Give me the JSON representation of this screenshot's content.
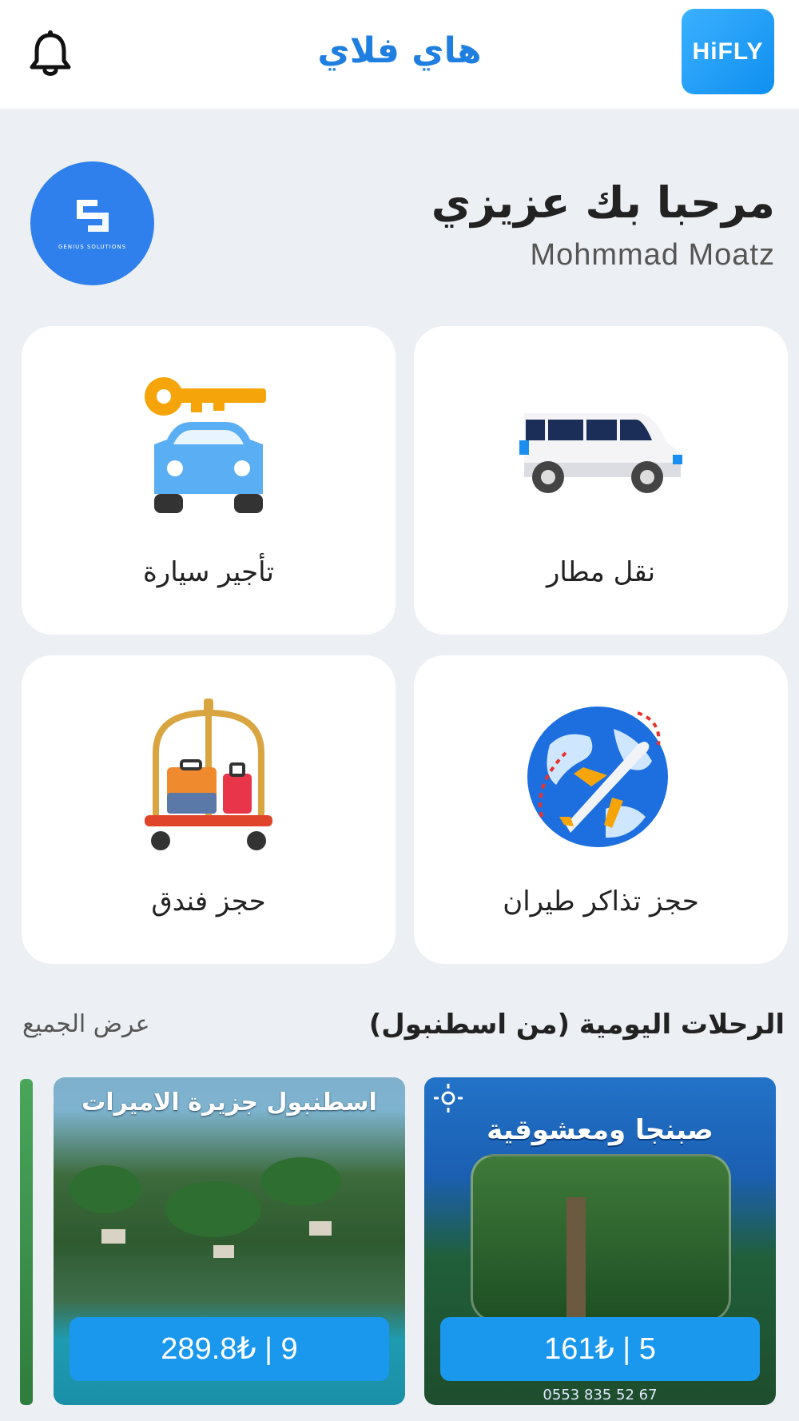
{
  "header": {
    "title": "هاي فلاي",
    "logo_text": "HiFLY",
    "notification_icon": "bell-icon"
  },
  "greeting": {
    "title": "مرحبا بك عزيزي",
    "name": "Mohmmad Moatz",
    "company_logo_text": "GENIUS SOLUTIONS"
  },
  "services": [
    {
      "label": "نقل مطار",
      "icon": "van-icon"
    },
    {
      "label": "تأجير سيارة",
      "icon": "car-key-icon"
    },
    {
      "label": "حجز تذاكر طيران",
      "icon": "globe-plane-icon"
    },
    {
      "label": "حجز فندق",
      "icon": "luggage-cart-icon"
    }
  ],
  "daily_trips": {
    "title": "الرحلات اليومية (من اسطنبول)",
    "view_all": "عرض الجميع",
    "items": [
      {
        "heading": "صبنجا ومعشوقية",
        "price": "161₺ | 5",
        "phone": "0553 835 52 67"
      },
      {
        "heading": "اسطنبول جزيرة الاميرات",
        "price": "289.8₺ | 9"
      }
    ]
  },
  "colors": {
    "accent": "#1f7fe0",
    "background": "#eceff3",
    "card": "#ffffff",
    "price_pill": "#1a98ee"
  }
}
